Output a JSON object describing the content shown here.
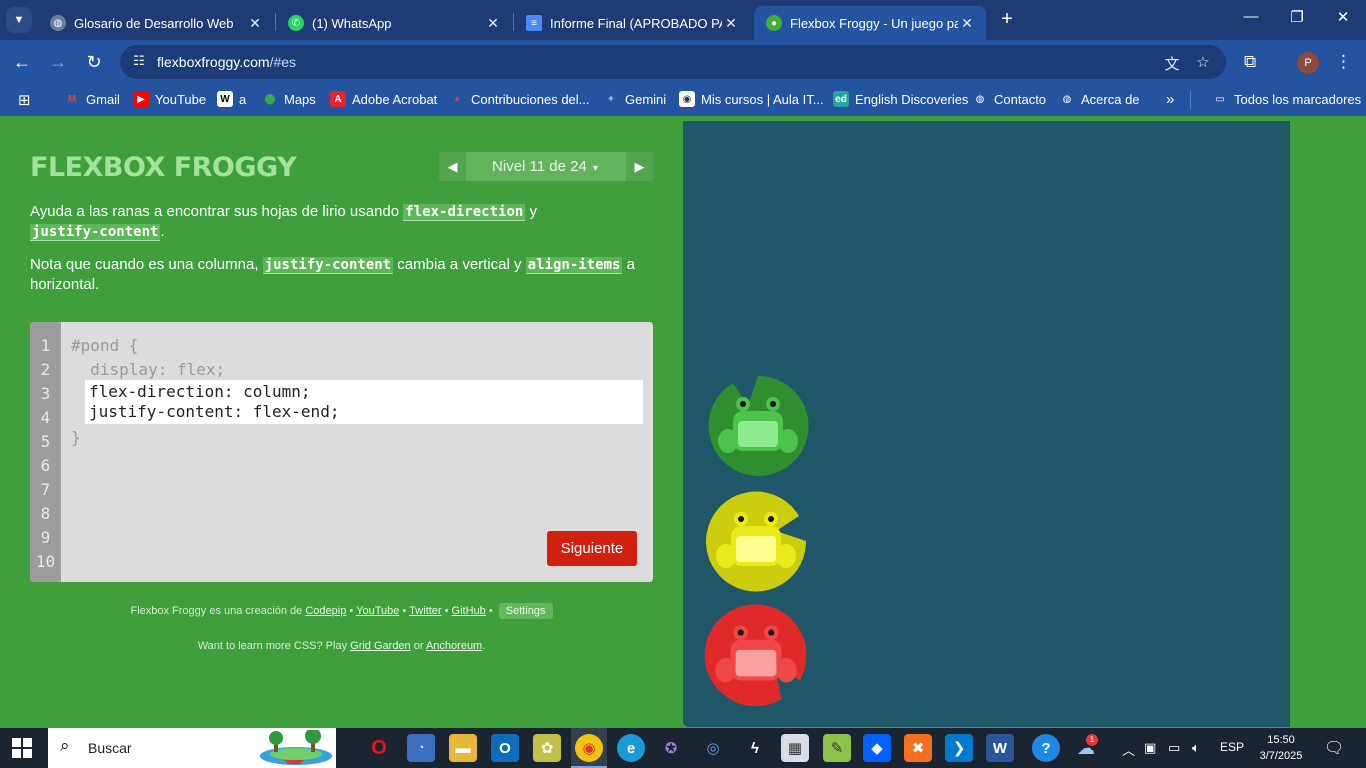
{
  "tabs": [
    {
      "title": "Glosario de Desarrollo Web",
      "icon": "globe-icon",
      "active": false
    },
    {
      "title": "(1) WhatsApp",
      "icon": "whatsapp-icon",
      "active": false
    },
    {
      "title": "Informe Final (APROBADO PARA",
      "icon": "google-docs-icon",
      "active": false
    },
    {
      "title": "Flexbox Froggy - Un juego para",
      "icon": "frog-favicon",
      "active": true
    }
  ],
  "address": {
    "domain": "flexboxfroggy.com",
    "path": "/#es"
  },
  "bookmarks": [
    {
      "label": "Gmail",
      "icon": "gmail-icon",
      "color": "#ffffff"
    },
    {
      "label": "YouTube",
      "icon": "youtube-icon",
      "color": "#ff0000"
    },
    {
      "label": "a",
      "icon": "wikipedia-icon",
      "color": "#ffffff"
    },
    {
      "label": "Maps",
      "icon": "maps-icon",
      "color": "#34a853"
    },
    {
      "label": "Adobe Acrobat",
      "icon": "acrobat-icon",
      "color": "#e3242b"
    },
    {
      "label": "Contribuciones del...",
      "icon": "contrib-icon",
      "color": "#e8305a"
    },
    {
      "label": "Gemini",
      "icon": "gemini-icon",
      "color": "#8fb5ff"
    },
    {
      "label": "Mis cursos | Aula IT...",
      "icon": "aula-icon",
      "color": "#ffffff"
    },
    {
      "label": "English Discoveries",
      "icon": "ed-icon",
      "color": "#26a69a"
    },
    {
      "label": "Contacto",
      "icon": "globe-icon",
      "color": "#ffffff"
    },
    {
      "label": "Acerca de",
      "icon": "globe-icon",
      "color": "#ffffff"
    }
  ],
  "bookmarks_all": "Todos los marcadores",
  "game": {
    "logo": "FLEXBOX FROGGY",
    "level_label": "Nivel 11 de 24",
    "instructions": {
      "p1_before": "Ayuda a las ranas a encontrar sus hojas de lirio usando",
      "p1_kw1": "flex-direction",
      "p1_mid": "y",
      "p1_kw2": "justify-content",
      "p1_end": ".",
      "p2_before": "Nota que cuando es una columna,",
      "p2_kw1": "justify-content",
      "p2_mid": "cambia a vertical y",
      "p2_kw2": "align-items",
      "p2_after": "a horizontal."
    },
    "editor": {
      "line_numbers": [
        "1",
        "2",
        "3",
        "4",
        "5",
        "6",
        "7",
        "8",
        "9",
        "10"
      ],
      "code_before": [
        "#pond {",
        "  display: flex;"
      ],
      "answer": "flex-direction: column;\njustify-content: flex-end;",
      "code_after": "}",
      "next_label": "Siguiente"
    },
    "credits": {
      "prefix": "Flexbox Froggy es una creación de",
      "codepip": "Codepip",
      "youtube": "YouTube",
      "twitter": "Twitter",
      "github": "GitHub",
      "sep": "•",
      "settings": "Settings"
    },
    "more": {
      "prefix": "Want to learn more CSS? Play",
      "grid_garden": "Grid Garden",
      "or": "or",
      "anchoreum": "Anchoreum",
      "end": "."
    },
    "frogs": [
      {
        "color": "green",
        "pad": "#2f8f2f",
        "body": "#4cc44c",
        "belly": "#8eea8e"
      },
      {
        "color": "yellow",
        "pad": "#cdcd10",
        "body": "#eaea1a",
        "belly": "#fdfd90"
      },
      {
        "color": "red",
        "pad": "#e02a2a",
        "body": "#f04848",
        "belly": "#f9a0a0"
      }
    ]
  },
  "taskbar": {
    "search_label": "Buscar",
    "lang": "ESP",
    "time": "15:50",
    "date": "3/7/2025",
    "weather_badge": "1"
  }
}
